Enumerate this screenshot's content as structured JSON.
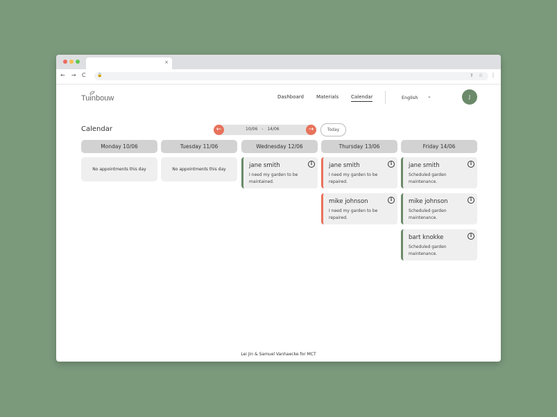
{
  "browser": {
    "tab_close": "×",
    "back": "←",
    "forward": "→",
    "reload": "C",
    "lock": "🔒",
    "share_icon": "⇪",
    "star_icon": "☆",
    "menu": "⋮"
  },
  "header": {
    "logo": "Tuinbouw",
    "nav": [
      "Dashboard",
      "Materials",
      "Calendar"
    ],
    "active_nav": "Calendar",
    "language": "English",
    "language_chevron": "⌄",
    "avatar_initial": "J"
  },
  "calendar": {
    "title": "Calendar",
    "prev_arrow": "←",
    "next_arrow": "→",
    "range_start": "10/06",
    "range_sep": "-",
    "range_end": "14/06",
    "today_label": "Today",
    "info_glyph": "i",
    "days": [
      {
        "header": "Monday 10/06",
        "empty_text": "No appointments this day"
      },
      {
        "header": "Tuesday 11/06",
        "empty_text": "No appointments this day"
      },
      {
        "header": "Wednesday 12/06",
        "appointments": [
          {
            "name": "jane smith",
            "description": "I need my garden to be maintained.",
            "status": "maintenance",
            "color": "#6b8a6a"
          }
        ]
      },
      {
        "header": "Thursday 13/06",
        "appointments": [
          {
            "name": "jane smith",
            "description": "I need my garden to be repaired.",
            "status": "repair",
            "color": "#e8725b"
          },
          {
            "name": "mike johnson",
            "description": "I need my garden to be repaired.",
            "status": "repair",
            "color": "#e8725b"
          }
        ]
      },
      {
        "header": "Friday 14/06",
        "appointments": [
          {
            "name": "jane smith",
            "description": "Scheduled garden maintenance.",
            "status": "maintenance",
            "color": "#6b8a6a"
          },
          {
            "name": "mike johnson",
            "description": "Scheduled garden maintenance.",
            "status": "maintenance",
            "color": "#6b8a6a"
          },
          {
            "name": "bart knokke",
            "description": "Scheduled garden maintenance.",
            "status": "maintenance",
            "color": "#6b8a6a"
          }
        ]
      }
    ]
  },
  "footer": {
    "text": "Lei Jin & Samuel Vanhaecke for MCT"
  },
  "colors": {
    "accent": "#e8725b",
    "green": "#6b8a6a",
    "background": "#7b9a7c"
  }
}
